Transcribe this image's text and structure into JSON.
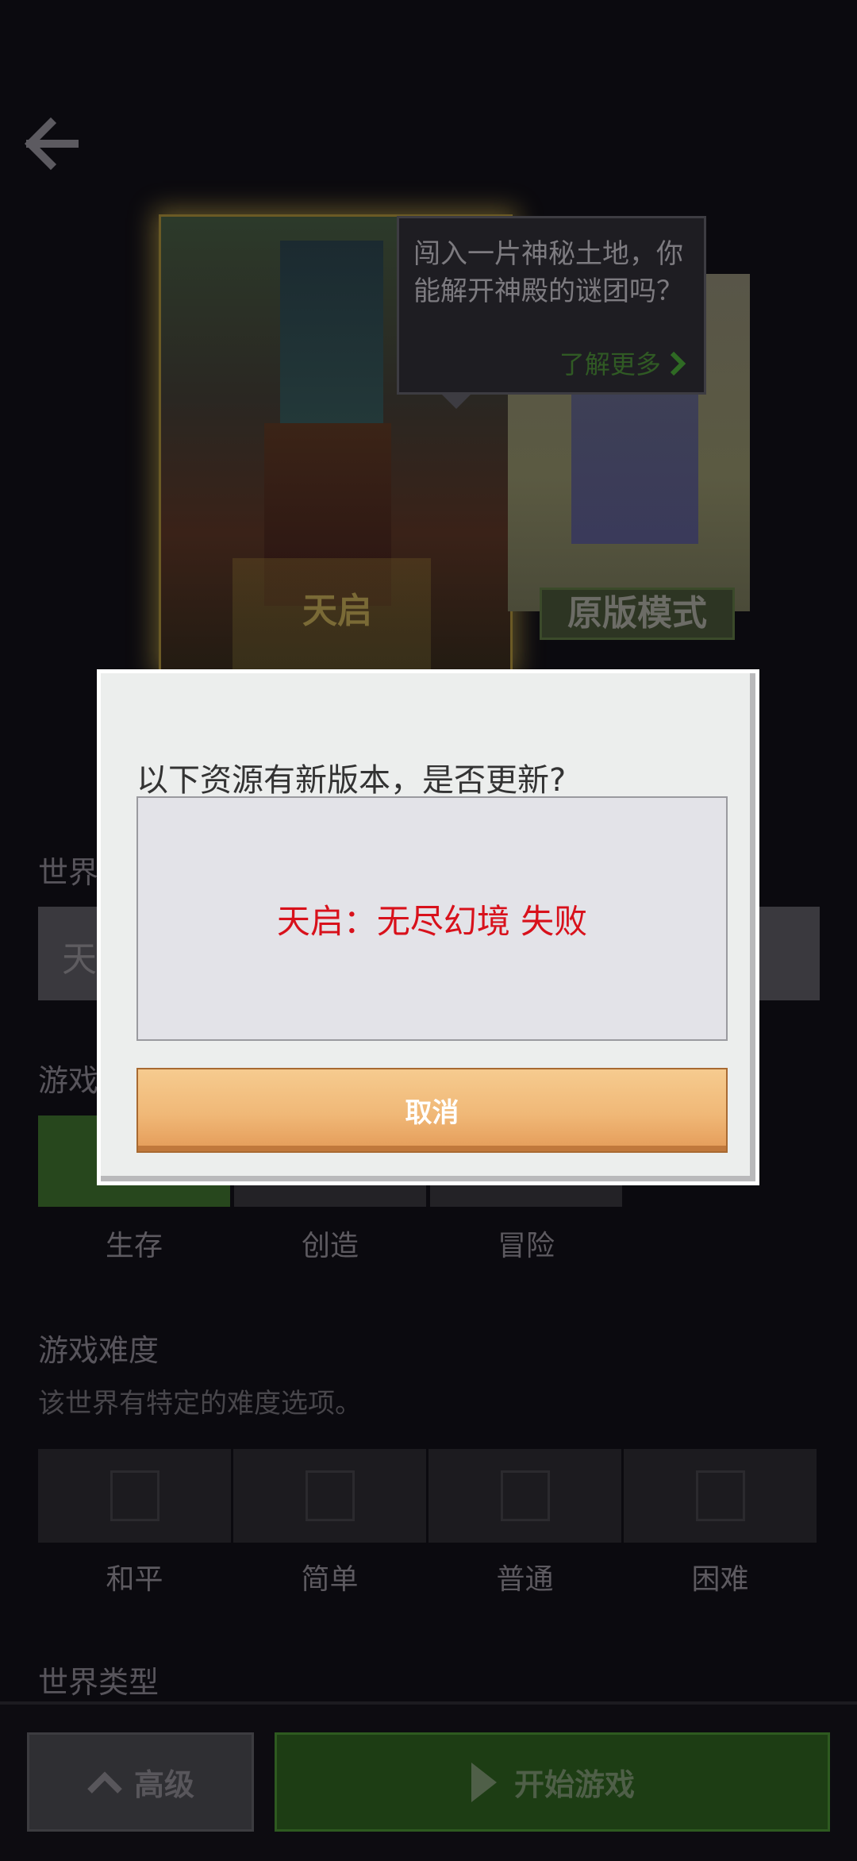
{
  "tooltip": {
    "text": "闯入一片神秘土地，你能解开神殿的谜团吗？",
    "link": "了解更多"
  },
  "cards": {
    "main_title": "天启",
    "side_title": "原版模式"
  },
  "background": {
    "world_name_label": "世界",
    "world_name_value": "天",
    "game_mode_label": "游戏",
    "modes": [
      "生存",
      "创造",
      "冒险"
    ],
    "difficulty_label": "游戏难度",
    "difficulty_hint": "该世界有特定的难度选项。",
    "difficulties": [
      "和平",
      "简单",
      "普通",
      "困难"
    ],
    "world_type_label": "世界类型"
  },
  "bottom": {
    "advanced_label": "高级",
    "start_label": "开始游戏"
  },
  "dialog": {
    "title": "以下资源有新版本，是否更新?",
    "items": [
      "天启：无尽幻境 失败"
    ],
    "cancel_label": "取消"
  },
  "colors": {
    "error_text": "#d8111b",
    "cancel_button": "#f0b877",
    "accent_green": "#27471d"
  },
  "icons": [
    "back-arrow-icon",
    "chevron-right-icon",
    "chevron-up-icon",
    "play-icon",
    "peaceful-icon",
    "easy-icon",
    "normal-icon",
    "hard-icon"
  ]
}
